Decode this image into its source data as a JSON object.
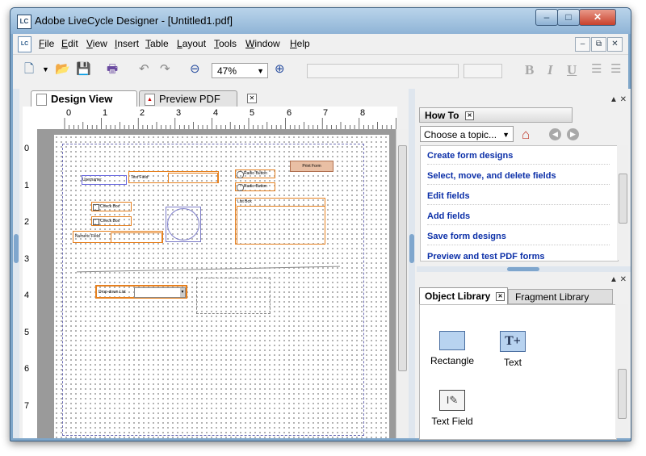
{
  "window": {
    "title": "Adobe LiveCycle Designer - [Untitled1.pdf]",
    "app_icon_text": "LC",
    "controls": {
      "minimize": "–",
      "maximize": "□",
      "close": "✕"
    }
  },
  "menubar": {
    "items": [
      "File",
      "Edit",
      "View",
      "Insert",
      "Table",
      "Layout",
      "Tools",
      "Window",
      "Help"
    ],
    "mdi_controls": [
      "–",
      "⧉",
      "✕"
    ]
  },
  "toolbar": {
    "zoom_value": "47%",
    "bold": "B",
    "italic": "I",
    "underline": "U"
  },
  "doc_tabs": [
    {
      "label": "Design View",
      "active": true
    },
    {
      "label": "Preview PDF",
      "active": false
    }
  ],
  "ruler": {
    "h_ticks": [
      "0",
      "1",
      "2",
      "3",
      "4",
      "5",
      "6",
      "7",
      "8"
    ],
    "v_ticks": [
      "0",
      "1",
      "2",
      "3",
      "4",
      "5",
      "6",
      "7"
    ]
  },
  "form": {
    "print_button": "Print Form",
    "username_label": "Username:",
    "text_field_label": "Text Field",
    "radio1": "Radio Button",
    "radio2": "Radio Button",
    "list_box": "List Box",
    "checkbox1": "Check Box",
    "checkbox2": "Check Box",
    "numeric_field": "Numeric Field",
    "dropdown_list": "Drop-down List"
  },
  "howto": {
    "tab_label": "How To",
    "topic_select": "Choose a topic...",
    "items": [
      "Create form designs",
      "Select, move, and delete fields",
      "Edit fields",
      "Add fields",
      "Save form designs",
      "Preview and test PDF forms"
    ]
  },
  "library": {
    "tabs": [
      {
        "label": "Object Library",
        "active": true
      },
      {
        "label": "Fragment Library",
        "active": false
      }
    ],
    "items": [
      {
        "label": "Rectangle",
        "icon": "rectangle-icon"
      },
      {
        "label": "Text",
        "icon": "text-tool-icon"
      },
      {
        "label": "Text Field",
        "icon": "text-field-icon"
      }
    ]
  }
}
